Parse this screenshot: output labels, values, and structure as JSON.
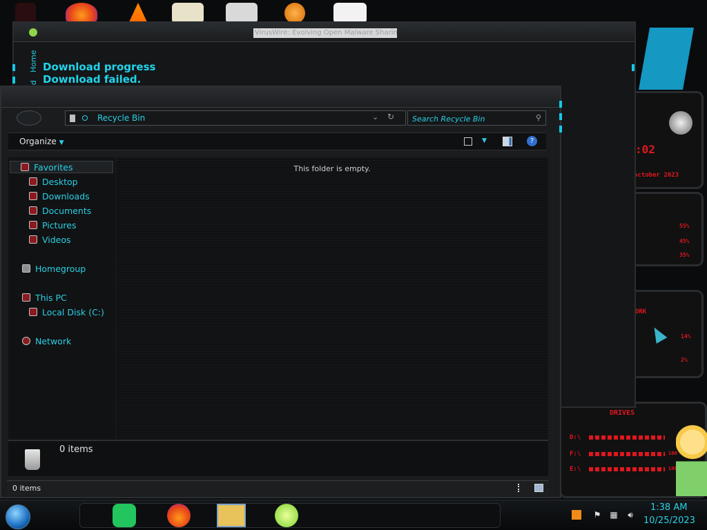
{
  "back_window": {
    "title": "VirusWire: Evolving Open Malware Sharing",
    "tabs": [
      "Home",
      "ad"
    ],
    "download_title": "Download progress",
    "download_status": "Download failed."
  },
  "explorer": {
    "address": "Recycle Bin",
    "search_placeholder": "Search Recycle Bin",
    "organize_label": "Organize",
    "empty_message": "This folder is empty.",
    "nav": {
      "favorites": "Favorites",
      "desktop": "Desktop",
      "downloads": "Downloads",
      "documents": "Documents",
      "pictures": "Pictures",
      "videos": "Videos",
      "homegroup": "Homegroup",
      "this_pc": "This PC",
      "local_disk": "Local Disk (C:)",
      "network": "Network"
    },
    "details_count": "0 items",
    "status_count": "0 items"
  },
  "gadgets": {
    "time": ":02",
    "date": "october 2023",
    "cpu_values": [
      "55%",
      "45%",
      "35%"
    ],
    "network_values": [
      "14%",
      "2%"
    ],
    "drives_label": "DRIVES",
    "drive_letters": [
      "D:\\",
      "F:\\",
      "E:\\"
    ],
    "drive_values": [
      "",
      "100",
      "100"
    ],
    "network_label": "ORK"
  },
  "taskbar": {
    "time": "1:38 AM",
    "date": "10/25/2023"
  },
  "colors": {
    "accent": "#2ad0e6",
    "red": "#e0171e"
  }
}
